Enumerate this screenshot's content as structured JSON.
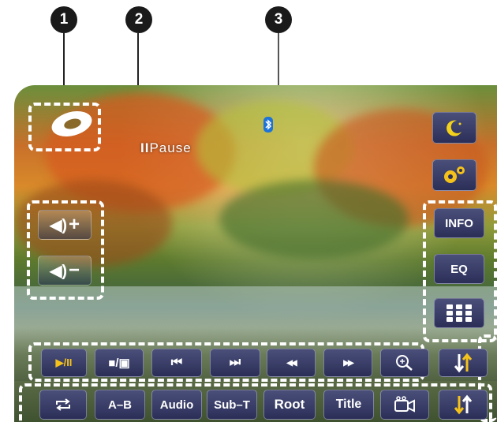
{
  "callouts": [
    "1",
    "2",
    "3"
  ],
  "status": {
    "pause_label": "Pause"
  },
  "volume": {
    "up_label": "+",
    "down_label": "−"
  },
  "side_buttons": {
    "info": "INFO",
    "eq": "EQ"
  },
  "bottom_bar_row1": {
    "play_pause": "▶/II",
    "stop_screen": "■/▣",
    "prev": "⏮",
    "next": "⏭",
    "rewind": "◀◀",
    "fast_forward": "▶▶"
  },
  "bottom_bar_row2": {
    "a_b": "A–B",
    "audio": "Audio",
    "subtitle": "Sub–T",
    "root": "Root",
    "title": "Title"
  },
  "colors": {
    "button_bg": "#2b2f58",
    "callout_bg": "#1a1a1a",
    "arrow_yellow": "#f4c21b",
    "moon": "#f4d21b"
  }
}
